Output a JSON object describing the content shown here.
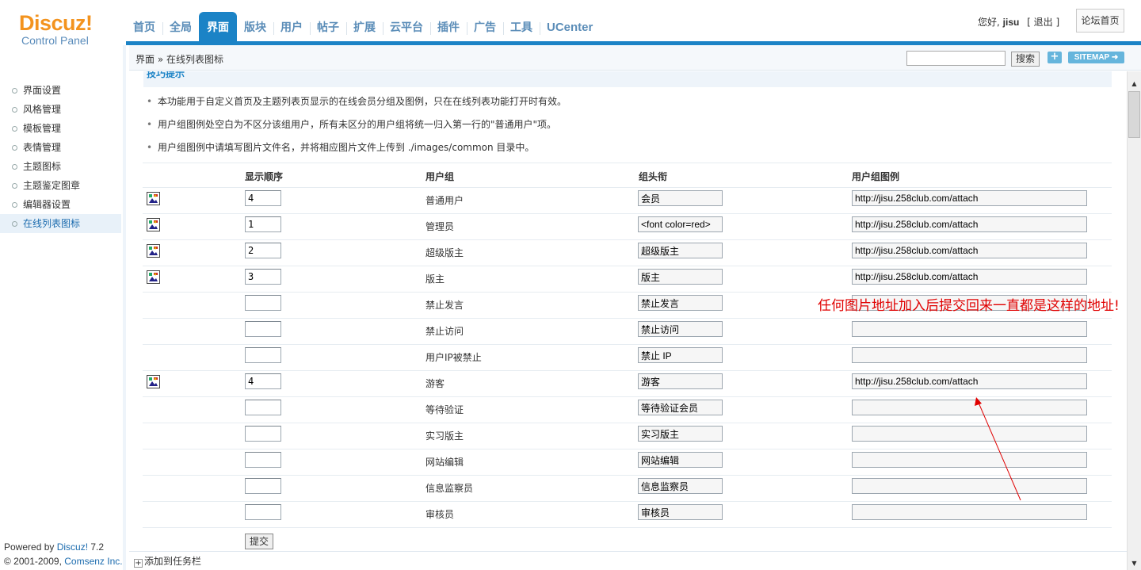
{
  "logo": {
    "main": "Discuz!",
    "sub": "Control Panel"
  },
  "nav": {
    "items": [
      "首页",
      "全局",
      "界面",
      "版块",
      "用户",
      "帖子",
      "扩展",
      "云平台",
      "插件",
      "广告",
      "工具",
      "UCenter"
    ],
    "active": "界面"
  },
  "user": {
    "greeting": "您好,",
    "name": "jisu",
    "logout": "[ 退出 ]",
    "forum_home": "论坛首页"
  },
  "breadcrumb": "界面 » 在线列表图标",
  "search": {
    "value": "",
    "button": "搜索",
    "plus": "+",
    "sitemap": "SITEMAP ➜"
  },
  "sidebar": {
    "items": [
      "界面设置",
      "风格管理",
      "模板管理",
      "表情管理",
      "主题图标",
      "主题鉴定图章",
      "编辑器设置",
      "在线列表图标"
    ],
    "active_index": 7,
    "footer_powered": "Powered by ",
    "footer_brand": "Discuz!",
    "footer_version": " 7.2",
    "footer_copy": "© 2001-2009, ",
    "footer_company": "Comsenz Inc."
  },
  "tips": {
    "title": "技巧提示",
    "items": [
      "本功能用于自定义首页及主题列表页显示的在线会员分组及图例，只在在线列表功能打开时有效。",
      "用户组图例处空白为不区分该组用户，所有未区分的用户组将统一归入第一行的\"普通用户\"项。",
      "用户组图例中请填写图片文件名，并将相应图片文件上传到 ./images/common 目录中。"
    ]
  },
  "table": {
    "headers": {
      "order": "显示顺序",
      "group": "用户组",
      "stars": "组头衔",
      "legend": "用户组图例"
    },
    "rows": [
      {
        "has_icon": true,
        "order": "4",
        "group": "普通用户",
        "stars": "会员",
        "legend": "http://jisu.258club.com/attach"
      },
      {
        "has_icon": true,
        "order": "1",
        "group": "管理员",
        "stars": "<font color=red>",
        "legend": "http://jisu.258club.com/attach"
      },
      {
        "has_icon": true,
        "order": "2",
        "group": "超级版主",
        "stars": "超级版主",
        "legend": "http://jisu.258club.com/attach"
      },
      {
        "has_icon": true,
        "order": "3",
        "group": "版主",
        "stars": "版主",
        "legend": "http://jisu.258club.com/attach"
      },
      {
        "has_icon": false,
        "order": "",
        "group": "禁止发言",
        "stars": "禁止发言",
        "legend": ""
      },
      {
        "has_icon": false,
        "order": "",
        "group": "禁止访问",
        "stars": "禁止访问",
        "legend": ""
      },
      {
        "has_icon": false,
        "order": "",
        "group": "用户IP被禁止",
        "stars": "禁止 IP",
        "legend": ""
      },
      {
        "has_icon": true,
        "order": "4",
        "group": "游客",
        "stars": "游客",
        "legend": "http://jisu.258club.com/attach"
      },
      {
        "has_icon": false,
        "order": "",
        "group": "等待验证",
        "stars": "等待验证会员",
        "legend": ""
      },
      {
        "has_icon": false,
        "order": "",
        "group": "实习版主",
        "stars": "实习版主",
        "legend": ""
      },
      {
        "has_icon": false,
        "order": "",
        "group": "网站编辑",
        "stars": "网站编辑",
        "legend": ""
      },
      {
        "has_icon": false,
        "order": "",
        "group": "信息监察员",
        "stars": "信息监察员",
        "legend": ""
      },
      {
        "has_icon": false,
        "order": "",
        "group": "审核员",
        "stars": "审核员",
        "legend": ""
      }
    ],
    "submit": "提交"
  },
  "annotation": "任何图片地址加入后提交回来一直都是这样的地址!",
  "taskbar": {
    "add": "添加到任务栏"
  },
  "colors": {
    "accent": "#1b83c6",
    "logo": "#f3931e",
    "annotation": "#e00000"
  }
}
